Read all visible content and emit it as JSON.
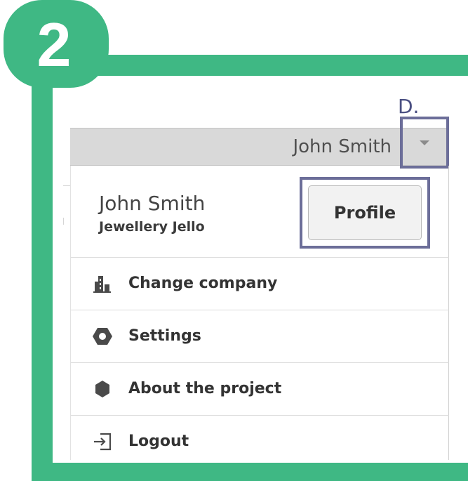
{
  "step": {
    "number": "2",
    "color": "#3fb884"
  },
  "callout": {
    "label": "D.",
    "outline_color": "#6c6e99"
  },
  "header": {
    "user_name": "John Smith",
    "dropdown_icon": "caret-down-icon"
  },
  "user_card": {
    "name": "John Smith",
    "company": "Jewellery Jello",
    "profile_label": "Profile"
  },
  "menu": {
    "items": [
      {
        "label": "Change company",
        "icon": "building-icon"
      },
      {
        "label": "Settings",
        "icon": "hexagon-gear-icon"
      },
      {
        "label": "About the project",
        "icon": "hexagon-icon"
      },
      {
        "label": "Logout",
        "icon": "logout-icon"
      }
    ]
  }
}
